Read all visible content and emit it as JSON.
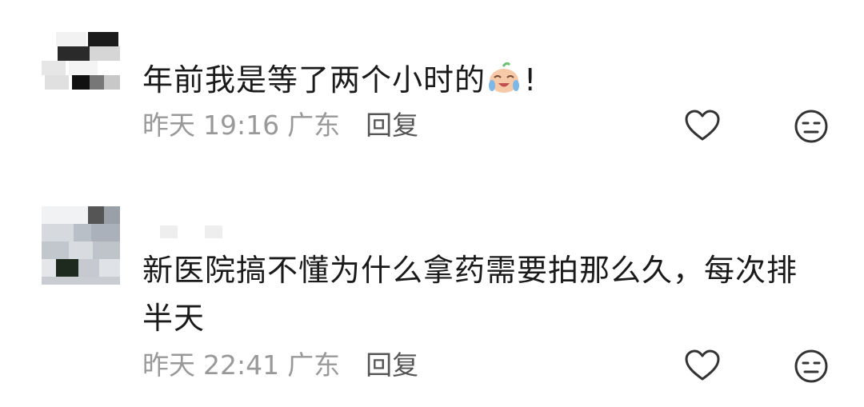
{
  "comments": [
    {
      "text": "年前我是等了两个小时的",
      "suffix": "!",
      "emoji": "crying-laughing-emoji-icon",
      "date": "昨天",
      "time": "19:16",
      "location": "广东",
      "reply_label": "回复"
    },
    {
      "text": "新医院搞不懂为什么拿药需要拍那么久，每次排半天",
      "date": "昨天",
      "time": "22:41",
      "location": "广东",
      "reply_label": "回复"
    }
  ],
  "icons": {
    "like": "heart-icon",
    "dislike": "meh-face-icon"
  },
  "colors": {
    "text": "#1a1a1a",
    "meta": "#999999",
    "reply": "#555555",
    "icon": "#333333"
  }
}
